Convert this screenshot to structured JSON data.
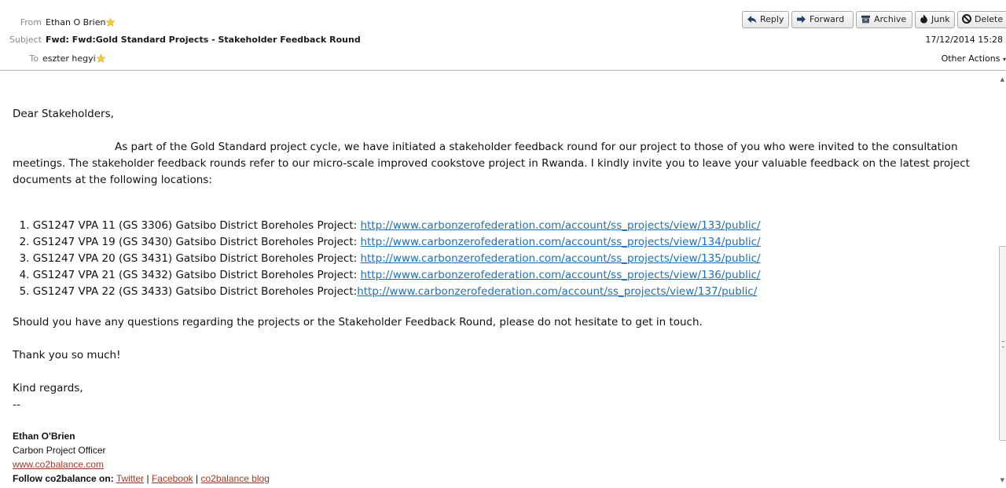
{
  "header": {
    "from_label": "From",
    "from_value": "Ethan O Brien",
    "subject_label": "Subject",
    "subject_value": "Fwd: Fwd:Gold Standard Projects - Stakeholder Feedback Round",
    "to_label": "To",
    "to_value": "eszter hegyi",
    "date": "17/12/2014 15:28",
    "other_actions": "Other Actions"
  },
  "toolbar": {
    "reply": "Reply",
    "forward": "Forward",
    "archive": "Archive",
    "junk": "Junk",
    "delete": "Delete"
  },
  "body": {
    "greeting": "Dear Stakeholders,",
    "intro": "As part of the Gold Standard project cycle, we have initiated a stakeholder feedback round for our project to those of you who were invited to the consultation meetings.  The stakeholder feedback rounds refer to our micro-scale improved cookstove project in Rwanda. I kindly invite you to leave your valuable feedback on the latest project documents at the following locations:",
    "projects": [
      {
        "num": "1.",
        "text": "GS1247 VPA 11 (GS 3306) Gatsibo District Boreholes Project: ",
        "url": "http://www.carbonzerofederation.com/account/ss_projects/view/133/public/"
      },
      {
        "num": "2.",
        "text": "GS1247 VPA 19 (GS 3430)  Gatsibo District Boreholes Project: ",
        "url": "http://www.carbonzerofederation.com/account/ss_projects/view/134/public/"
      },
      {
        "num": "3.",
        "text": "GS1247 VPA 20 (GS 3431)  Gatsibo District Boreholes Project: ",
        "url": "http://www.carbonzerofederation.com/account/ss_projects/view/135/public/"
      },
      {
        "num": "4.",
        "text": "GS1247 VPA 21 (GS 3432)  Gatsibo District Boreholes Project: ",
        "url": "http://www.carbonzerofederation.com/account/ss_projects/view/136/public/"
      },
      {
        "num": "5.",
        "text": "GS1247 VPA 22 (GS 3433) Gatsibo District Boreholes Project:",
        "url": "http://www.carbonzerofederation.com/account/ss_projects/view/137/public/"
      }
    ],
    "questions": "Should you have any questions regarding the projects or the Stakeholder Feedback Round, please do not hesitate to get in touch.",
    "thanks": "Thank you so much!",
    "regards": "Kind regards,",
    "dashes": "--"
  },
  "signature": {
    "name": "Ethan O'Brien",
    "title": "Carbon Project Officer",
    "website": "www.co2balance.com",
    "follow_label": "Follow co2balance on:",
    "twitter": "Twitter",
    "facebook": "Facebook",
    "blog": "co2balance blog",
    "separator": "|"
  },
  "colors": {
    "link": "#1f6fbf",
    "signature_link": "#9e3b26",
    "header_label": "#8a8a8a"
  },
  "icons": {
    "reply": "reply-arrow-icon",
    "forward": "forward-arrow-icon",
    "archive": "archive-box-icon",
    "junk": "fire-icon",
    "delete": "no-entry-icon",
    "star": "star-icon"
  }
}
